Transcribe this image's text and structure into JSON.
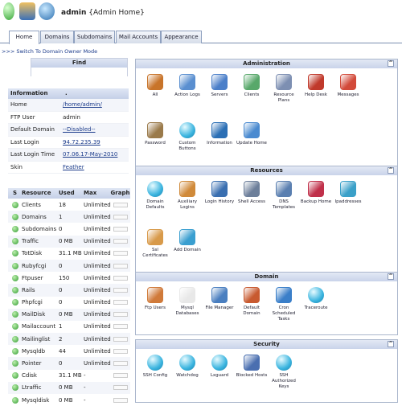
{
  "header": {
    "user": "admin",
    "subtitle": "{Admin Home}",
    "icons": [
      "status-ball-icon",
      "users-icon",
      "globe-user-icon"
    ]
  },
  "tabs": [
    "Home",
    "Domains",
    "Subdomains",
    "Mail Accounts",
    "Appearance"
  ],
  "switch_link": ">>> Switch To Domain Owner Mode",
  "find": {
    "label": "Find"
  },
  "information": {
    "title": "Information",
    "dot": ".",
    "rows": [
      {
        "k": "Home",
        "v": "/home/admin/",
        "link": true
      },
      {
        "k": "FTP User",
        "v": "admin",
        "link": false
      },
      {
        "k": "Default Domain",
        "v": "--Disabled--",
        "link": true
      },
      {
        "k": "Last Login",
        "v": "94.72.235.39",
        "link": true
      },
      {
        "k": "Last Login Time",
        "v": "07.06.17-May-2010",
        "link": true
      },
      {
        "k": "Skin",
        "v": "Feather",
        "link": true
      }
    ]
  },
  "resources_table": {
    "headers": [
      "S",
      "Resource",
      "Used",
      "Max",
      "Graph"
    ],
    "rows": [
      {
        "name": "Clients",
        "used": "18",
        "max": "Unlimited"
      },
      {
        "name": "Domains",
        "used": "1",
        "max": "Unlimited"
      },
      {
        "name": "Subdomains",
        "used": "0",
        "max": "Unlimited"
      },
      {
        "name": "Traffic",
        "used": "0 MB",
        "max": "Unlimited"
      },
      {
        "name": "TotDisk",
        "used": "31.1 MB",
        "max": "Unlimited"
      },
      {
        "name": "Rubyfcgi",
        "used": "0",
        "max": "Unlimited"
      },
      {
        "name": "Ftpuser",
        "used": "150",
        "max": "Unlimited"
      },
      {
        "name": "Rails",
        "used": "0",
        "max": "Unlimited"
      },
      {
        "name": "Phpfcgi",
        "used": "0",
        "max": "Unlimited"
      },
      {
        "name": "MailDisk",
        "used": "0 MB",
        "max": "Unlimited"
      },
      {
        "name": "Mailaccount",
        "used": "1",
        "max": "Unlimited"
      },
      {
        "name": "Mailinglist",
        "used": "2",
        "max": "Unlimited"
      },
      {
        "name": "Mysqldb",
        "used": "44",
        "max": "Unlimited"
      },
      {
        "name": "Pointer",
        "used": "0",
        "max": "Unlimited"
      },
      {
        "name": "Cdisk",
        "used": "31.1 MB",
        "max": "-"
      },
      {
        "name": "Ltraffic",
        "used": "0 MB",
        "max": "-"
      },
      {
        "name": "Mysqldisk",
        "used": "0 MB",
        "max": "-"
      }
    ]
  },
  "panels": [
    {
      "title": "Administration",
      "items": [
        {
          "label": "All",
          "icon": "tools-icon",
          "color": "#c8742a"
        },
        {
          "label": "Action Logs",
          "icon": "gears-icon",
          "color": "#5a8fd0"
        },
        {
          "label": "Servers",
          "icon": "servers-icon",
          "color": "#4b7fc9"
        },
        {
          "label": "Clients",
          "icon": "clients-icon",
          "color": "#58a86a"
        },
        {
          "label": "Resource Plans",
          "icon": "plans-icon",
          "color": "#7d8fb2"
        },
        {
          "label": "Help Desk",
          "icon": "helpdesk-icon",
          "color": "#c0392b"
        },
        {
          "label": "Messages",
          "icon": "messages-icon",
          "color": "#d24a3a"
        },
        {
          "label": "Password",
          "icon": "key-icon",
          "color": "#9a7a4a"
        },
        {
          "label": "Custom Buttons",
          "icon": "ball-icon",
          "color": "ball"
        },
        {
          "label": "Information",
          "icon": "info-icon",
          "color": "#2b6fb5"
        },
        {
          "label": "Update Home",
          "icon": "update-icon",
          "color": "#4a8ad0"
        }
      ]
    },
    {
      "title": "Resources",
      "items": [
        {
          "label": "Domain Defaults",
          "icon": "ball-icon",
          "color": "ball"
        },
        {
          "label": "Auxiliary Logins",
          "icon": "logins-icon",
          "color": "#d08a3a"
        },
        {
          "label": "Login History",
          "icon": "history-icon",
          "color": "#3a6fb0"
        },
        {
          "label": "Shell Access",
          "icon": "shell-icon",
          "color": "#6d7f9a"
        },
        {
          "label": "DNS Templates",
          "icon": "dns-icon",
          "color": "#5a7fb0"
        },
        {
          "label": "Backup Home",
          "icon": "backup-icon",
          "color": "#c0304a"
        },
        {
          "label": "Ipaddresses",
          "icon": "ip-icon",
          "color": "#3aa0c8"
        },
        {
          "label": "Ssl Certificates",
          "icon": "certificate-icon",
          "color": "#d89a4a"
        },
        {
          "label": "Add Domain",
          "icon": "add-domain-icon",
          "color": "#3a9fd0"
        }
      ]
    },
    {
      "title": "Domain",
      "items": [
        {
          "label": "Ftp Users",
          "icon": "ftp-users-icon",
          "color": "#d07a3a"
        },
        {
          "label": "Mysql Databases",
          "icon": "mysql-icon",
          "color": "#e8e8e8"
        },
        {
          "label": "File Manager",
          "icon": "file-manager-icon",
          "color": "#4a7fc0"
        },
        {
          "label": "Default Domain",
          "icon": "default-domain-icon",
          "color": "#c85a30"
        },
        {
          "label": "Cron Scheduled Tasks",
          "icon": "cron-icon",
          "color": "#3a7fc9"
        },
        {
          "label": "Traceroute",
          "icon": "ball-icon",
          "color": "ball"
        }
      ]
    },
    {
      "title": "Security",
      "items": [
        {
          "label": "SSH Config",
          "icon": "ball-icon",
          "color": "ball"
        },
        {
          "label": "Watchdog",
          "icon": "ball-icon",
          "color": "ball"
        },
        {
          "label": "Lxguard",
          "icon": "ball-icon",
          "color": "ball"
        },
        {
          "label": "Blocked Hosts",
          "icon": "blocked-hosts-icon",
          "color": "#4a6fb0"
        },
        {
          "label": "SSH Authorized Keys",
          "icon": "ball-icon",
          "color": "ball"
        }
      ]
    }
  ]
}
